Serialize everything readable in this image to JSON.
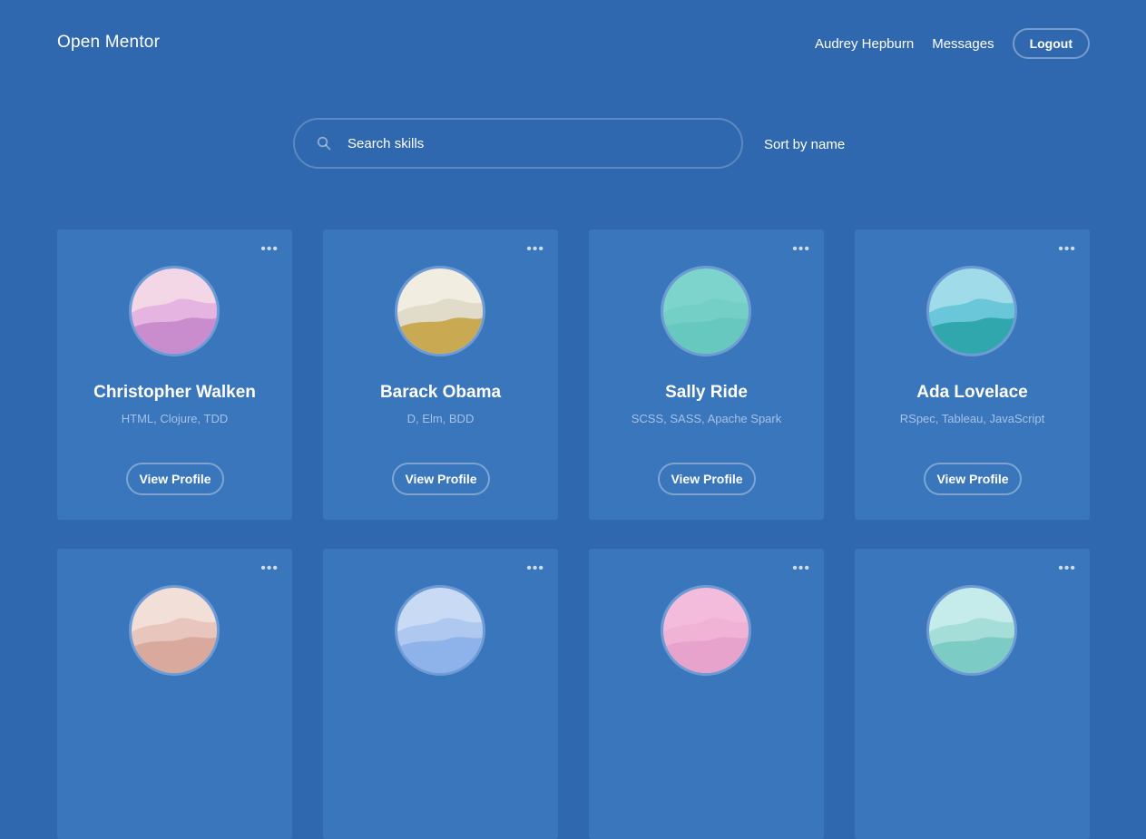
{
  "header": {
    "brand": "Open Mentor",
    "user_name": "Audrey Hepburn",
    "messages_label": "Messages",
    "logout_label": "Logout"
  },
  "search": {
    "placeholder": "Search skills",
    "value": "",
    "sort_label": "Sort by name"
  },
  "colors": {
    "background": "#2f68ae",
    "card": "#3a76bb",
    "skills_text": "#a5c2e8"
  },
  "mentors": [
    {
      "name": "Christopher Walken",
      "skills": "HTML, Clojure, TDD",
      "menu_label": "•••",
      "view_label": "View Profile",
      "avatar": {
        "sky": "#f4d7e6",
        "hill1": "#e3aede",
        "hill2": "#c98ccd"
      }
    },
    {
      "name": "Barack Obama",
      "skills": "D, Elm, BDD",
      "menu_label": "•••",
      "view_label": "View Profile",
      "avatar": {
        "sky": "#f1ede0",
        "hill1": "#ded7c4",
        "hill2": "#c9aa52"
      }
    },
    {
      "name": "Sally Ride",
      "skills": "SCSS, SASS, Apache Spark",
      "menu_label": "•••",
      "view_label": "View Profile",
      "avatar": {
        "sky": "#7dd4cc",
        "hill1": "#72cec5",
        "hill2": "#67c8bf"
      }
    },
    {
      "name": "Ada Lovelace",
      "skills": "RSpec, Tableau, JavaScript",
      "menu_label": "•••",
      "view_label": "View Profile",
      "avatar": {
        "sky": "#9fdbe9",
        "hill1": "#5fc3d6",
        "hill2": "#2fa7ad"
      }
    },
    {
      "name": "",
      "skills": "",
      "menu_label": "•••",
      "view_label": "",
      "avatar": {
        "sky": "#f2dfd7",
        "hill1": "#e7c2b8",
        "hill2": "#d9a99e"
      }
    },
    {
      "name": "",
      "skills": "",
      "menu_label": "•••",
      "view_label": "",
      "avatar": {
        "sky": "#c9daf5",
        "hill1": "#a9c4ef",
        "hill2": "#8eb2ea"
      }
    },
    {
      "name": "",
      "skills": "",
      "menu_label": "•••",
      "view_label": "",
      "avatar": {
        "sky": "#f3bcdc",
        "hill1": "#efb0d4",
        "hill2": "#e8a3cc"
      }
    },
    {
      "name": "",
      "skills": "",
      "menu_label": "•••",
      "view_label": "",
      "avatar": {
        "sky": "#c5ecea",
        "hill1": "#9fdcd6",
        "hill2": "#7ccbc4"
      }
    }
  ]
}
